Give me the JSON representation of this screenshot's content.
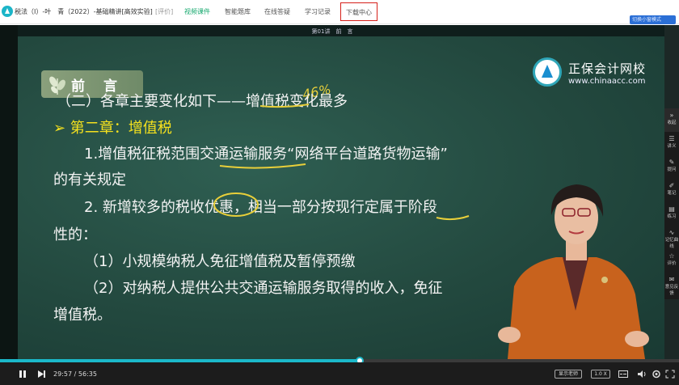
{
  "header": {
    "title": "税法（I）-叶　青（2022）-基础精讲[高效实验]",
    "rate": "[评价]",
    "tabs": [
      {
        "label": "视频课件",
        "active": true
      },
      {
        "label": "智能题库"
      },
      {
        "label": "在线答疑"
      },
      {
        "label": "学习记录"
      },
      {
        "label": "下载中心",
        "highlighted": true
      }
    ],
    "mini_window": "切换小窗模式"
  },
  "slide": {
    "lecture": "第01讲　前　言",
    "section_title": "前　言",
    "org_name": "正保会计网校",
    "org_url": "www.chinaacc.com",
    "hand_note": "46%",
    "lines": [
      "（二）各章主要变化如下——增值税变化最多",
      "➢ 第二章：增值税",
      "1.增值税征税范围交通运输服务“网络平台道路货物运输”",
      "的有关规定",
      "2. 新增较多的税收优惠，相当一部分按现行定属于阶段",
      "性的：",
      "（1）小规模纳税人免征增值税及暂停预缴",
      "（2）对纳税人提供公共交通运输服务取得的收入，免征",
      "增值税。"
    ]
  },
  "player": {
    "current_time": "29:57",
    "total_time": "56:35",
    "progress": 0.53,
    "show_teacher": "显示老师",
    "speed": "1.0 X"
  },
  "sidebar": [
    {
      "icon": "collapse-icon",
      "glyph": "»",
      "label": "收起"
    },
    {
      "icon": "notes-icon",
      "glyph": "☰",
      "label": "讲义"
    },
    {
      "icon": "ask-icon",
      "glyph": "✎",
      "label": "提问"
    },
    {
      "icon": "note-icon",
      "glyph": "✐",
      "label": "笔记"
    },
    {
      "icon": "practice-icon",
      "glyph": "▤",
      "label": "练习"
    },
    {
      "icon": "curve-icon",
      "glyph": "∿",
      "label": "记忆曲线"
    },
    {
      "icon": "star-icon",
      "glyph": "☆",
      "label": "评价"
    },
    {
      "icon": "feedback-icon",
      "glyph": "✉",
      "label": "意见反馈"
    }
  ]
}
